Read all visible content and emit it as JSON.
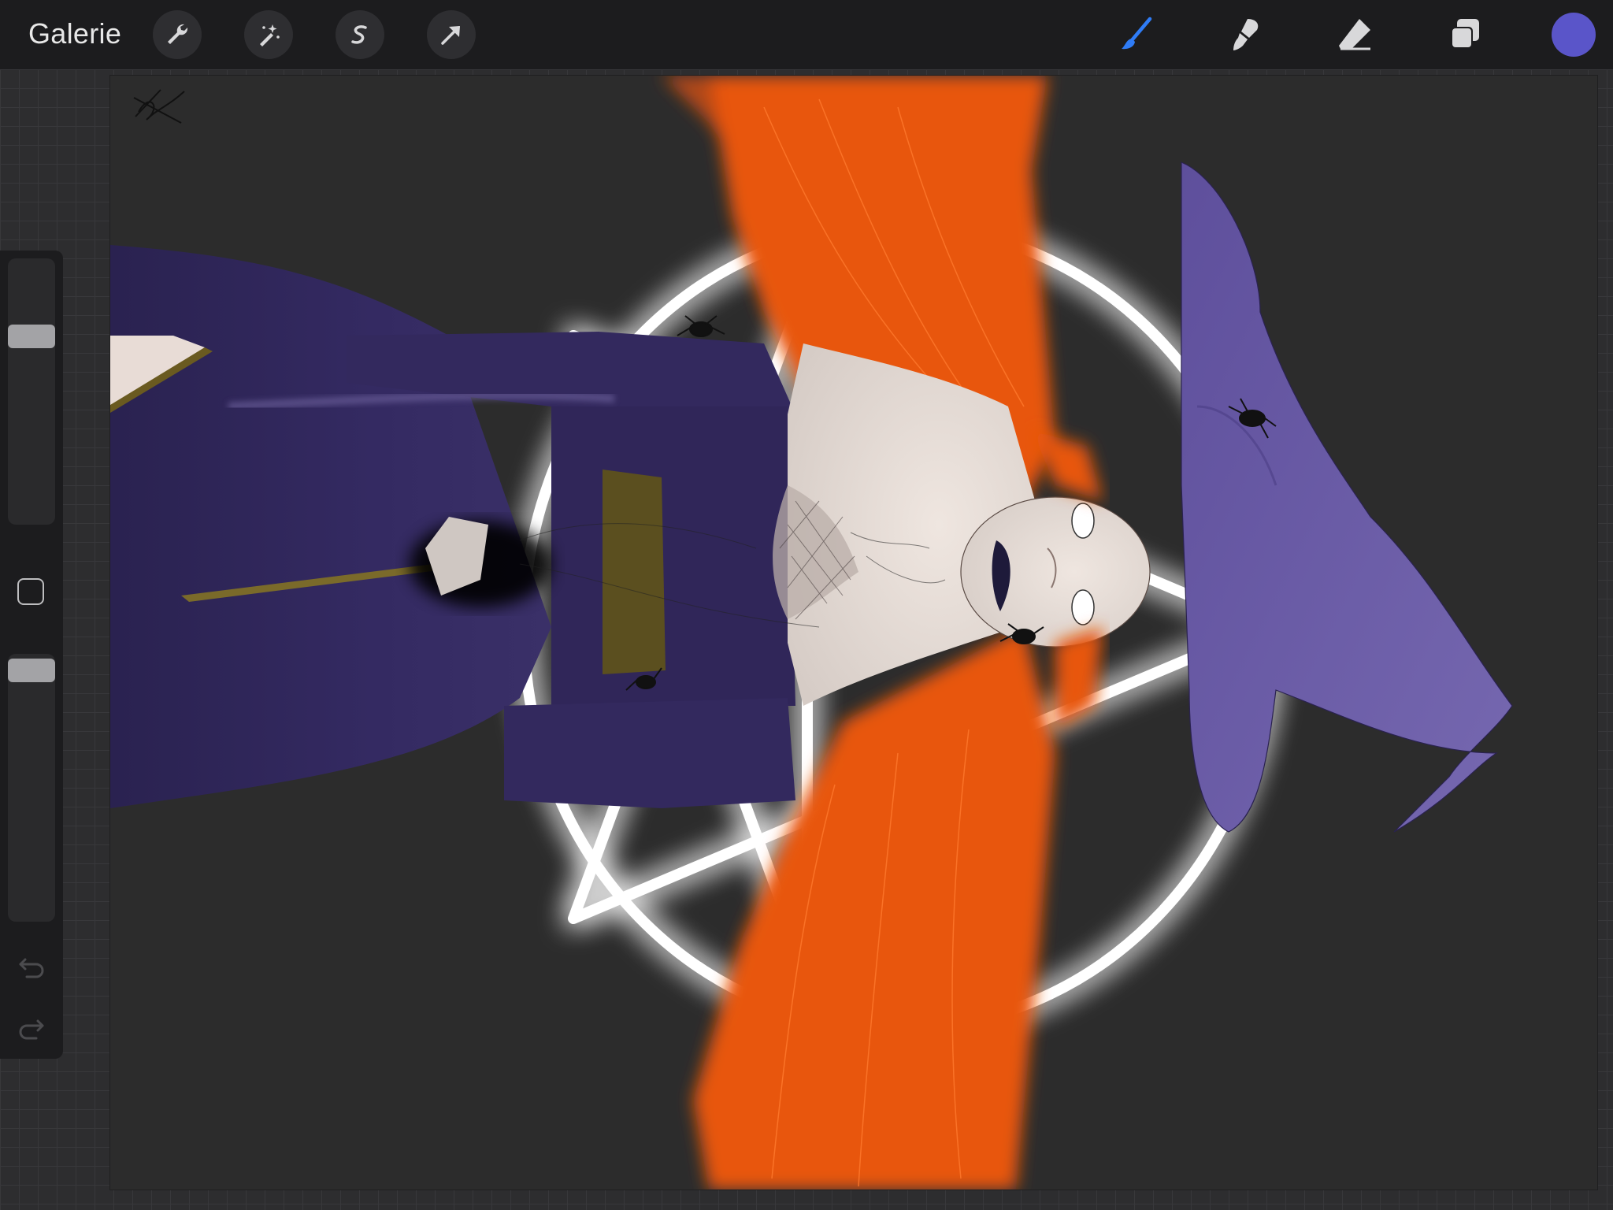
{
  "topbar": {
    "gallery_label": "Galerie",
    "left_tools": [
      {
        "name": "actions",
        "icon": "wrench-icon"
      },
      {
        "name": "adjustments",
        "icon": "magic-wand-icon"
      },
      {
        "name": "selection",
        "icon": "selection-s-icon"
      },
      {
        "name": "transform",
        "icon": "transform-arrow-icon"
      }
    ],
    "right_tools": [
      {
        "name": "brush",
        "icon": "brush-icon",
        "active": true
      },
      {
        "name": "smudge",
        "icon": "smudge-icon"
      },
      {
        "name": "eraser",
        "icon": "eraser-icon"
      },
      {
        "name": "layers",
        "icon": "layers-icon"
      }
    ],
    "active_color": "#5a55c9",
    "active_tool_color": "#2f7cf6"
  },
  "sidebar": {
    "brush_size_level": 0.72,
    "opacity_level": 0.98,
    "buttons": [
      "modify-button",
      "undo-button",
      "redo-button"
    ]
  },
  "canvas": {
    "artwork": "witch-illustration",
    "colors": {
      "background": "#2c2c2c",
      "hair": "#e8560a",
      "dress": "#33295e",
      "hat": "#6a5aa6",
      "skin": "#e6ddd6",
      "glow": "#ffffff",
      "belt": "#5b4f1f"
    }
  }
}
